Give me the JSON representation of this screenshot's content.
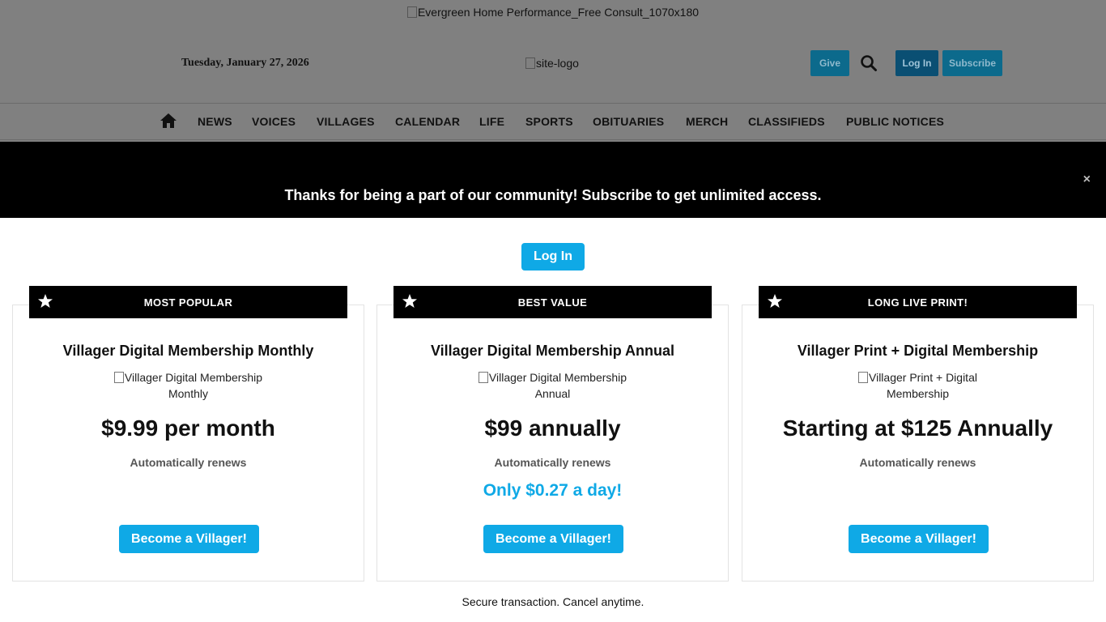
{
  "header": {
    "ad_alt": "Evergreen Home Performance_Free Consult_1070x180",
    "date": "Tuesday, January 27, 2026",
    "logo_alt": "site-logo",
    "give_label": "Give",
    "login_label": "Log In",
    "subscribe_label": "Subscribe"
  },
  "nav": {
    "items": [
      "NEWS",
      "VOICES",
      "VILLAGES",
      "CALENDAR",
      "LIFE",
      "SPORTS",
      "OBITUARIES",
      "MERCH",
      "CLASSIFIEDS",
      "PUBLIC NOTICES"
    ]
  },
  "banner": {
    "text": "Thanks for being a part of our community! Subscribe to get unlimited access.",
    "close": "×"
  },
  "modal": {
    "login_label": "Log In",
    "footer": "Secure transaction. Cancel anytime.",
    "plans": [
      {
        "tag": "MOST POPULAR",
        "title": "Villager Digital Membership Monthly",
        "image_alt": "Villager Digital Membership Monthly",
        "price": "$9.99 per month",
        "renew": "Automatically renews",
        "per_day": "",
        "cta": "Become a Villager!"
      },
      {
        "tag": "BEST VALUE",
        "title": "Villager Digital Membership Annual",
        "image_alt": "Villager Digital Membership Annual",
        "price": "$99 annually",
        "renew": "Automatically renews",
        "per_day": "Only $0.27 a day!",
        "cta": "Become a Villager!"
      },
      {
        "tag": "LONG LIVE PRINT!",
        "title": "Villager Print + Digital Membership",
        "image_alt": "Villager Print + Digital Membership",
        "price": "Starting at $125 Annually",
        "renew": "Automatically renews",
        "per_day": "",
        "cta": "Become a Villager!"
      }
    ]
  },
  "colors": {
    "accent": "#0fa9e6",
    "banner_bg": "#000000",
    "overlay": "#808080"
  }
}
